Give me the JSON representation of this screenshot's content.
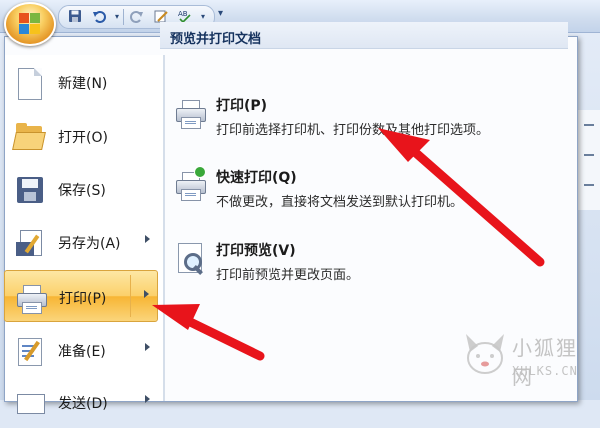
{
  "quick_access": {
    "icons": [
      "save-icon",
      "undo-icon",
      "redo-icon",
      "edit-icon",
      "spelling-icon"
    ],
    "more_glyph": "▾"
  },
  "app_menu": {
    "items": [
      {
        "label": "新建(N)",
        "icon": "new-document-icon"
      },
      {
        "label": "打开(O)",
        "icon": "open-folder-icon"
      },
      {
        "label": "保存(S)",
        "icon": "save-floppy-icon"
      },
      {
        "label": "另存为(A)",
        "icon": "save-as-icon",
        "has_submenu": true
      },
      {
        "label": "打印(P)",
        "icon": "printer-icon",
        "has_submenu": true,
        "active": true
      },
      {
        "label": "准备(E)",
        "icon": "prepare-icon",
        "has_submenu": true
      },
      {
        "label": "发送(D)",
        "icon": "send-icon",
        "has_submenu": true
      }
    ]
  },
  "print_submenu": {
    "header": "预览并打印文档",
    "items": [
      {
        "title": "打印(P)",
        "desc": "打印前选择打印机、打印份数及其他打印选项。",
        "icon": "printer-icon"
      },
      {
        "title": "快速打印(Q)",
        "desc": "不做更改，直接将文档发送到默认打印机。",
        "icon": "quick-print-icon"
      },
      {
        "title": "打印预览(V)",
        "desc": "打印前预览并更改页面。",
        "icon": "print-preview-icon"
      }
    ]
  },
  "annotation": {
    "arrow_color": "#e8141b"
  },
  "watermark": {
    "cn": "小狐狸网",
    "en": "XHLKS.CN"
  }
}
